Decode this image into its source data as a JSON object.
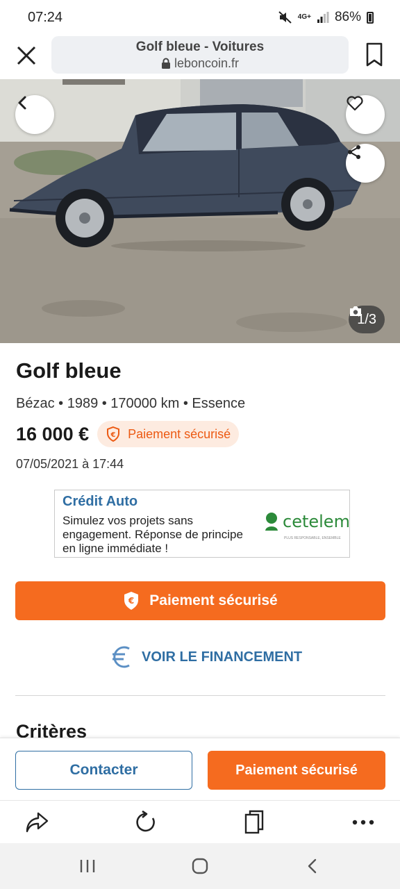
{
  "status": {
    "time": "07:24",
    "network": "4G+",
    "battery": "86%"
  },
  "browser": {
    "page_title": "Golf bleue - Voitures",
    "domain": "leboncoin.fr"
  },
  "gallery": {
    "counter": "1/3"
  },
  "ad": {
    "title": "Golf bleue",
    "meta": "Bézac • 1989 • 170000 km • Essence",
    "price": "16 000 €",
    "secure_badge": "Paiement sécurisé",
    "date": "07/05/2021 à 17:44"
  },
  "banner": {
    "title": "Crédit Auto",
    "text": "Simulez vos projets sans engagement. Réponse de principe en ligne immédiate !",
    "brand": "cetelem",
    "tagline": "PLUS RESPONSABLE, ENSEMBLE"
  },
  "actions": {
    "pay_button": "Paiement sécurisé",
    "financing_link": "VOIR LE FINANCEMENT",
    "criteria_heading": "Critères",
    "contact_button": "Contacter",
    "pay_button_sticky": "Paiement sécurisé"
  },
  "colors": {
    "accent_orange": "#f56b1f",
    "link_blue": "#2f6ea3",
    "cetelem_green": "#2c8a3a"
  },
  "icons": {
    "status": [
      "mute-icon",
      "network-4g-icon",
      "signal-icon",
      "battery-icon"
    ],
    "browser": [
      "close-icon",
      "lock-icon",
      "bookmark-icon"
    ],
    "gallery": [
      "back-arrow-icon",
      "heart-icon",
      "share-icon",
      "camera-icon"
    ],
    "toolbar": [
      "forward-share-icon",
      "reload-icon",
      "tabs-icon",
      "more-icon"
    ],
    "nav": [
      "recent-apps-icon",
      "home-icon",
      "back-icon"
    ]
  }
}
